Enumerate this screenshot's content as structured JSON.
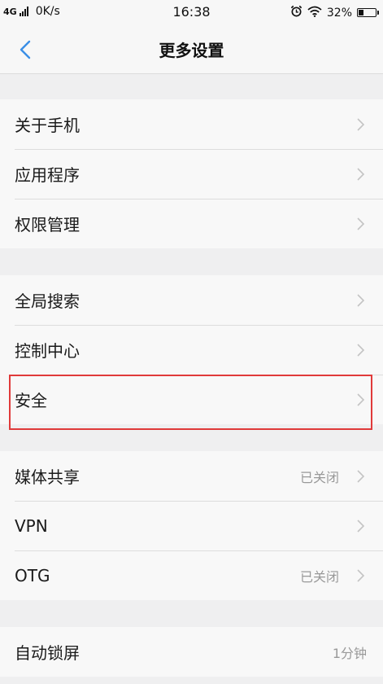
{
  "status_bar": {
    "network": "4G",
    "speed": "0K/s",
    "time": "16:38",
    "battery": "32%",
    "battery_level": 0.32,
    "icons": [
      "signal-icon",
      "alarm-icon",
      "wifi-icon",
      "battery-icon"
    ]
  },
  "header": {
    "title": "更多设置",
    "back_icon": "chevron-left-icon"
  },
  "groups": [
    {
      "items": [
        {
          "label": "关于手机"
        },
        {
          "label": "应用程序"
        },
        {
          "label": "权限管理"
        }
      ]
    },
    {
      "items": [
        {
          "label": "全局搜索"
        },
        {
          "label": "控制中心"
        },
        {
          "label": "安全",
          "highlighted": true
        }
      ]
    },
    {
      "items": [
        {
          "label": "媒体共享",
          "value": "已关闭"
        },
        {
          "label": "VPN"
        },
        {
          "label": "OTG",
          "value": "已关闭"
        }
      ]
    },
    {
      "items": [
        {
          "label": "自动锁屏",
          "value": "1分钟"
        }
      ]
    }
  ],
  "colors": {
    "accent": "#3a8ee6",
    "highlight": "#e03a3a",
    "background": "#efeff0",
    "row_background": "#f8f8f8",
    "value_text": "#999999"
  }
}
